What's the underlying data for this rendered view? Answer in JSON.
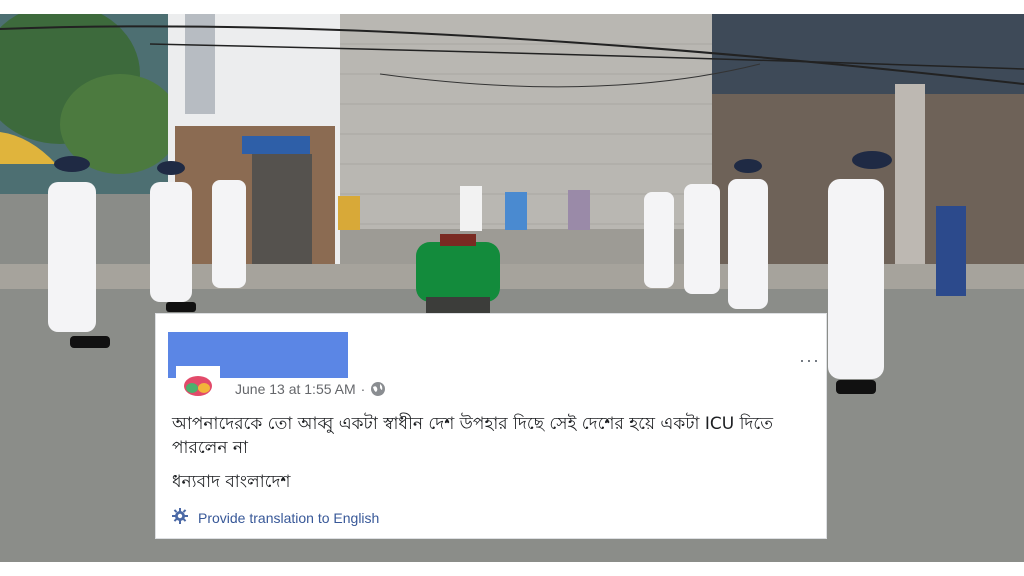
{
  "post": {
    "timestamp": "June 13 at 1:55 AM",
    "separator": "·",
    "text_line1": "আপনাদেরকে তো আব্বু একটা স্বাধীন দেশ উপহার দিছে সেই দেশের হয়ে একটা ICU দিতে পারলেন না",
    "text_line2": "ধন্যবাদ বাংলাদেশ",
    "translate_label": "Provide translation to English",
    "more_label": "···"
  },
  "icons": {
    "options": "more-options-icon",
    "privacy": "globe-icon",
    "translate": "gear-icon"
  },
  "colors": {
    "redaction": "#5b86e5",
    "link": "#385898",
    "meta": "#65676b",
    "text": "#1c1e21"
  }
}
